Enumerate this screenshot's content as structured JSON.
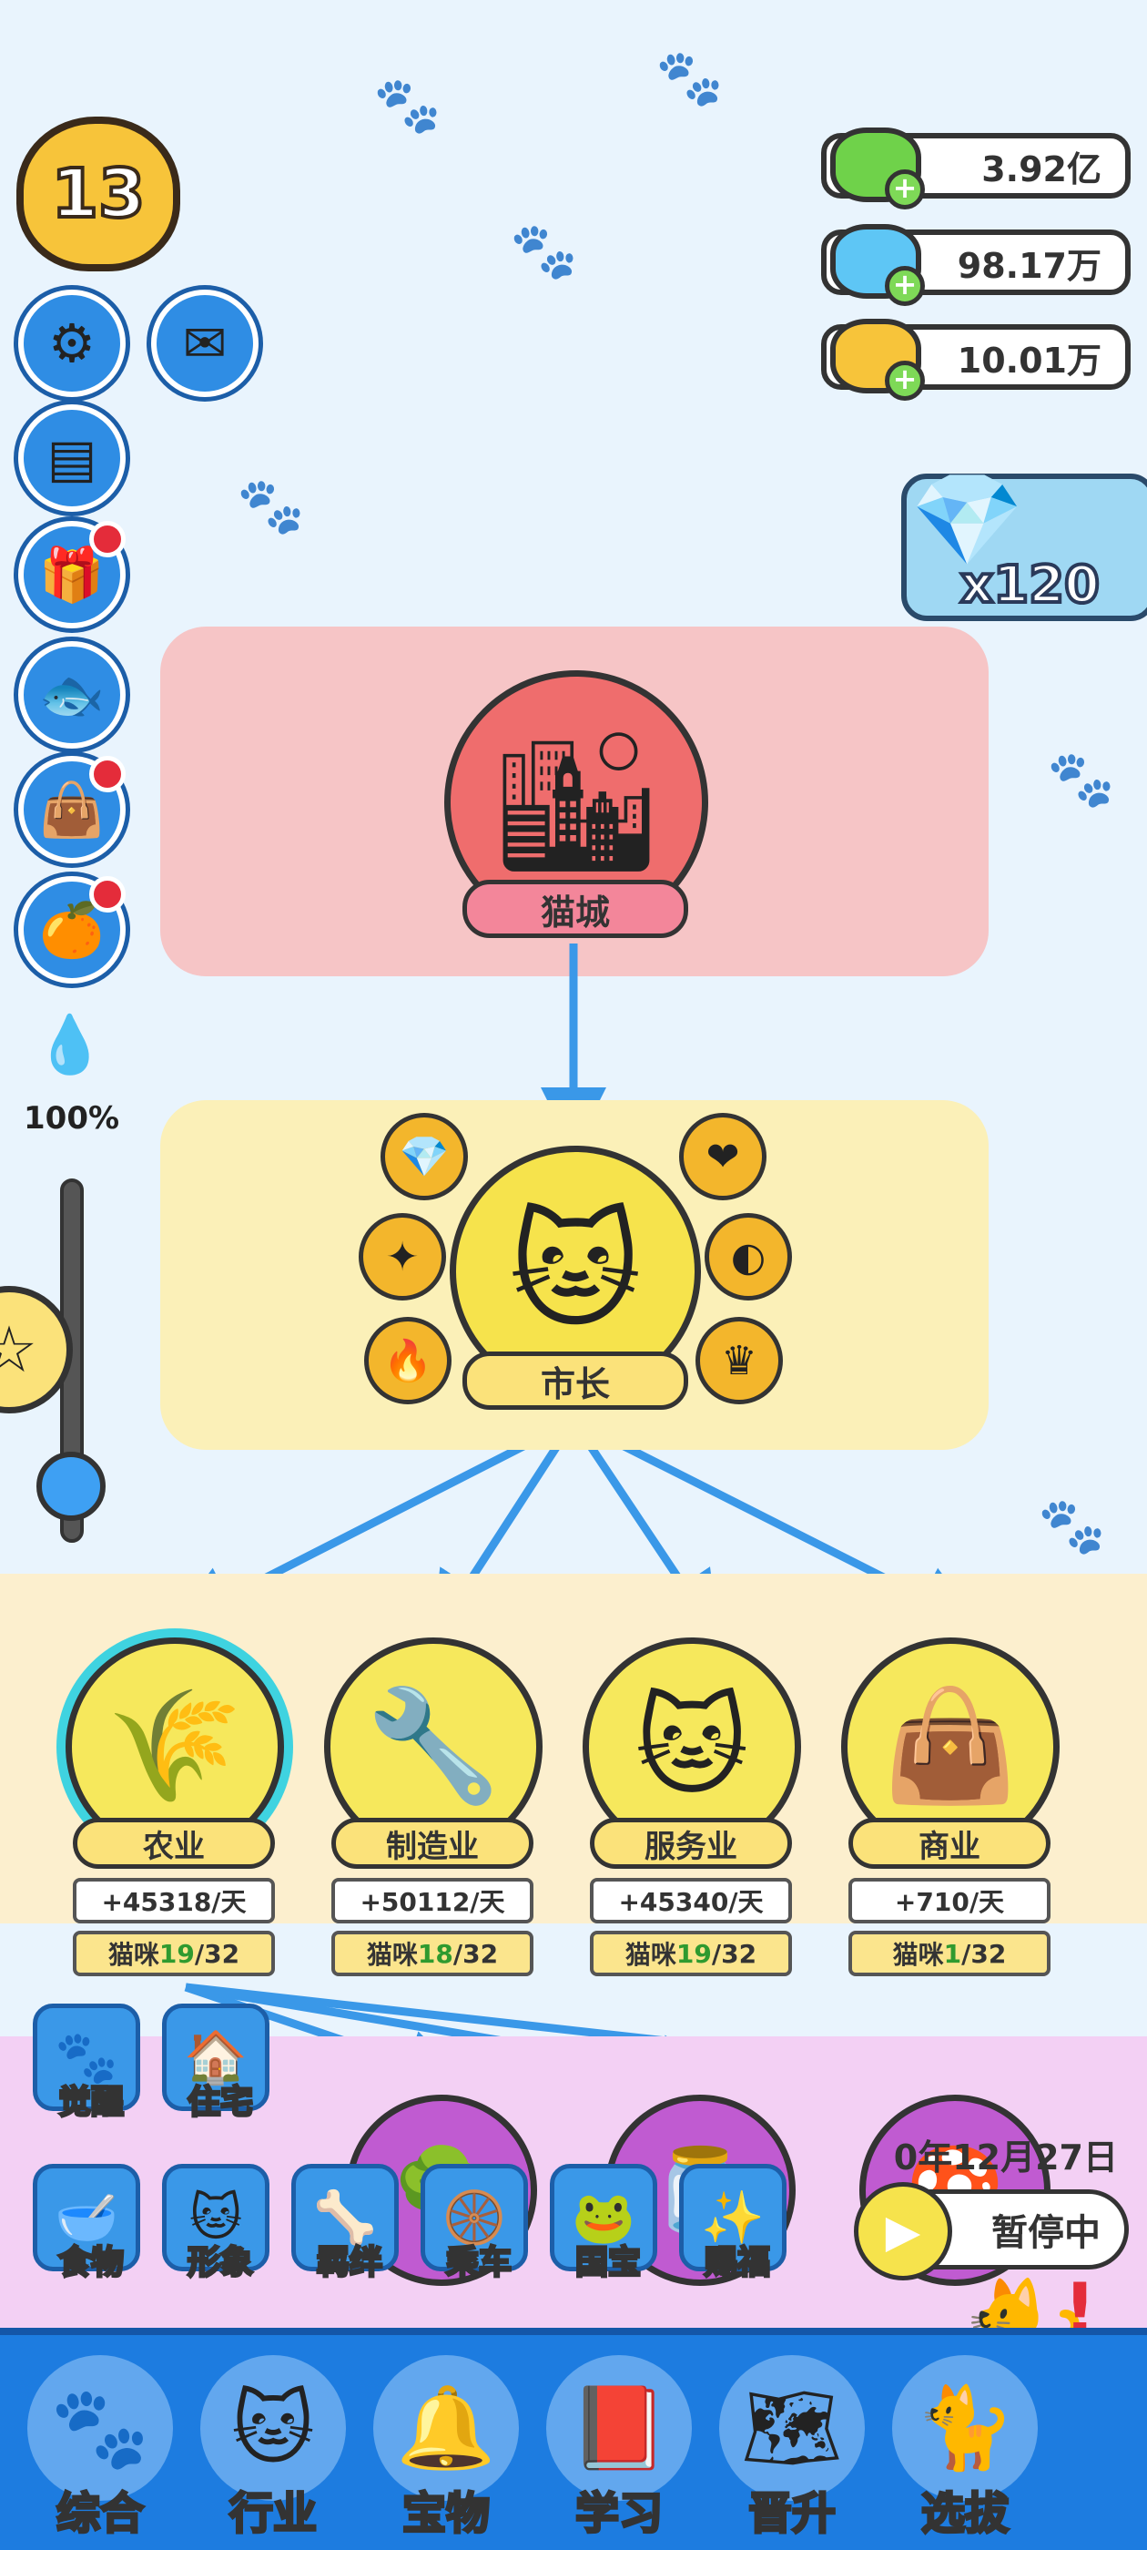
{
  "level": "13",
  "currencies": [
    {
      "icon": "green-gem-icon",
      "value": "3.92亿",
      "color": "#6fd24a"
    },
    {
      "icon": "blue-diamond-icon",
      "value": "98.17万",
      "color": "#5ec6f5"
    },
    {
      "icon": "gold-coin-icon",
      "value": "10.01万",
      "color": "#f7c43a"
    }
  ],
  "gem_bonus": "x120",
  "side_buttons": [
    {
      "name": "settings-button",
      "icon": "⚙"
    },
    {
      "name": "mail-button",
      "icon": "✉"
    },
    {
      "name": "folder-button",
      "icon": "▤"
    },
    {
      "name": "gift-button",
      "icon": "🎁",
      "dot": true
    },
    {
      "name": "fish-button",
      "icon": "🐟"
    },
    {
      "name": "shop-bag-button",
      "icon": "👜",
      "dot": true
    },
    {
      "name": "orange-button",
      "icon": "🍊",
      "dot": true
    }
  ],
  "speed": {
    "top_percent": "100%",
    "bottom_percent": "0%",
    "level": 0.0
  },
  "city": {
    "label": "猫城"
  },
  "mayor": {
    "label": "市长"
  },
  "industries": [
    {
      "label": "农业",
      "output": "+45318/天",
      "cats_prefix": "猫咪",
      "cats_used": "19",
      "cats_total": "/32",
      "icon": "🌾",
      "selected": true
    },
    {
      "label": "制造业",
      "output": "+50112/天",
      "cats_prefix": "猫咪",
      "cats_used": "18",
      "cats_total": "/32",
      "icon": "🔧",
      "selected": false
    },
    {
      "label": "服务业",
      "output": "+45340/天",
      "cats_prefix": "猫咪",
      "cats_used": "19",
      "cats_total": "/32",
      "icon": "🐱",
      "selected": false
    },
    {
      "label": "商业",
      "output": "+710/天",
      "cats_prefix": "猫咪",
      "cats_used": "1",
      "cats_total": "/32",
      "icon": "👜",
      "selected": false
    }
  ],
  "function_menu": [
    {
      "label": "觉醒",
      "icon": "🐾"
    },
    {
      "label": "住宅",
      "icon": "🏠"
    },
    {
      "label": "食物",
      "icon": "🥣"
    },
    {
      "label": "形象",
      "icon": "🐱"
    },
    {
      "label": "羁绊",
      "icon": "🦴"
    },
    {
      "label": "乘车",
      "icon": "🛞"
    },
    {
      "label": "国宝",
      "icon": "🐸"
    },
    {
      "label": "赐福",
      "icon": "✨"
    }
  ],
  "date": "0年12月27日",
  "pause": {
    "label": "暂停中"
  },
  "tabs": [
    {
      "label": "综合",
      "icon": "🐾"
    },
    {
      "label": "行业",
      "icon": "🐱"
    },
    {
      "label": "宝物",
      "icon": "🔔"
    },
    {
      "label": "学习",
      "icon": "📕"
    },
    {
      "label": "晋升",
      "icon": "🗺"
    },
    {
      "label": "选拔",
      "icon": "🐈"
    }
  ],
  "colors": {
    "accent": "#1d7ce0",
    "pink_panel": "#f6c5c6",
    "yellow_panel": "#fbf0b8",
    "arrow": "#3a98e8"
  }
}
